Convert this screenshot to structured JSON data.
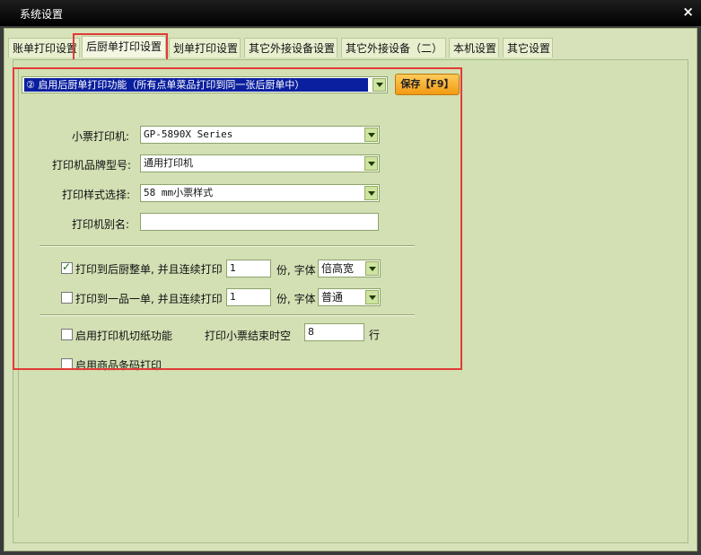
{
  "window": {
    "title": "系统设置",
    "close_glyph": "×"
  },
  "tabs": [
    "账单打印设置",
    "后厨单打印设置",
    "划单打印设置",
    "其它外接设备设置",
    "其它外接设备（二）",
    "本机设置",
    "其它设置"
  ],
  "active_tab_index": 1,
  "mode_select": {
    "value": "② 启用后厨单打印功能（所有点单菜品打印到同一张后厨单中）"
  },
  "save_button": {
    "label": "保存【F9】"
  },
  "printer": {
    "label": "小票打印机:",
    "value": "GP-5890X Series"
  },
  "brand": {
    "label": "打印机品牌型号:",
    "value": "通用打印机"
  },
  "style": {
    "label": "打印样式选择:",
    "value": "58  mm小票样式"
  },
  "alias": {
    "label": "打印机别名:",
    "value": ""
  },
  "whole_order": {
    "checked": true,
    "label": "打印到后厨整单, 并且连续打印",
    "copies": "1",
    "copies_unit": "份, 字体",
    "font_value": "倍高宽"
  },
  "per_item": {
    "checked": false,
    "label": "打印到一品一单, 并且连续打印",
    "copies": "1",
    "copies_unit": "份, 字体",
    "font_value": "普通"
  },
  "cutter": {
    "checked": false,
    "label": "启用打印机切纸功能"
  },
  "end_blank": {
    "label": "打印小票结束时空",
    "value": "8",
    "unit": "行"
  },
  "barcode": {
    "checked": false,
    "label": "启用商品条码打印"
  },
  "colors": {
    "highlight_box": "#e23b36",
    "selected_bg": "#0a1f9e",
    "panel_bg": "#d2e0b4",
    "save_button": "#f29a12"
  }
}
